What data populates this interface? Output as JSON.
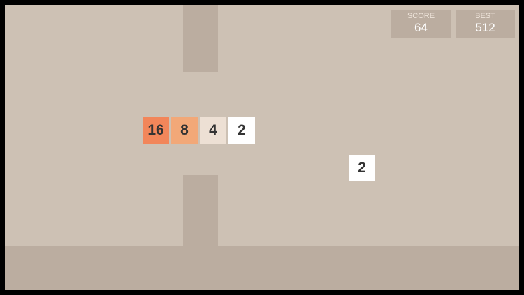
{
  "score": {
    "label": "SCORE",
    "value": "64"
  },
  "best": {
    "label": "BEST",
    "value": "512"
  },
  "snake_tiles": [
    "16",
    "8",
    "4",
    "2"
  ],
  "falling_tile": "2",
  "colors": {
    "background": "#cdc1b4",
    "pipe": "#bbada0",
    "ground": "#bbada0",
    "tile_16": "#f2865a",
    "tile_8": "#f2a878",
    "tile_4": "#ede0d4",
    "tile_2": "#ffffff"
  }
}
